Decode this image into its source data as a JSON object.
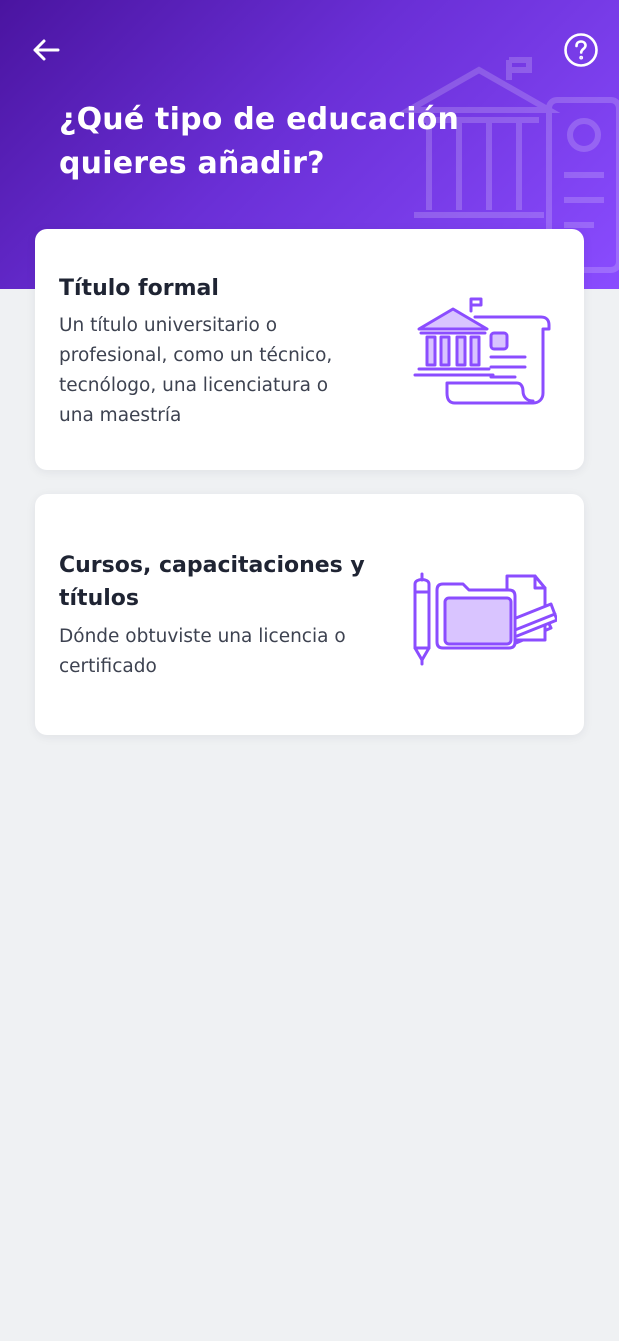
{
  "header": {
    "title": "¿Qué tipo de educación quieres añadir?"
  },
  "icons": {
    "back": "arrow-left-icon",
    "help": "help-circle-icon",
    "formal_degree": "university-diploma-illustration",
    "courses": "folder-documents-pen-illustration"
  },
  "options": [
    {
      "title": "Título formal",
      "description": "Un título universitario o profesional, como un técnico, tecnólogo, una licenciatura o una maestría"
    },
    {
      "title": "Cursos, capacitaciones y títulos",
      "description": "Dónde obtuviste una licencia o certificado"
    }
  ],
  "colors": {
    "header_start": "#4a14a0",
    "header_end": "#8a4cff",
    "accent": "#8b4dff",
    "accent_light": "#d9c4ff",
    "background": "#eff1f3",
    "card": "#ffffff",
    "text_primary": "#1f2433",
    "text_secondary": "#3d4250"
  }
}
